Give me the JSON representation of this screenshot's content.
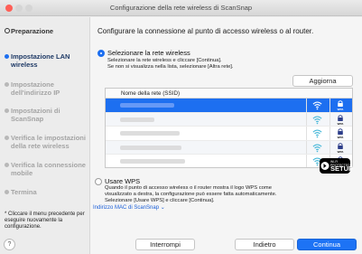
{
  "window": {
    "title": "Configurazione della rete wireless di ScanSnap"
  },
  "sidebar": {
    "steps": [
      {
        "label": "Preparazione",
        "state": "done"
      },
      {
        "label": "Impostazione LAN wireless",
        "state": "active"
      },
      {
        "label": "Impostazione dell'indirizzo IP",
        "state": "pending"
      },
      {
        "label": "Impostazioni di ScanSnap",
        "state": "pending"
      },
      {
        "label": "Verifica le impostazioni della rete wireless",
        "state": "pending"
      },
      {
        "label": "Verifica la connessione mobile",
        "state": "pending"
      },
      {
        "label": "Termina",
        "state": "pending"
      }
    ],
    "hint": "* Cliccare il menu precedente per eseguire nuovamente la configurazione.",
    "help_label": "?"
  },
  "main": {
    "heading": "Configurare la connessione al punto di accesso wireless o al router.",
    "option_select": {
      "label": "Selezionare la rete wireless",
      "desc": "Selezionare la rete wireless e cliccare [Continua].\nSe non si visualizza nella lista, selezionare [Altra rete].",
      "selected": true
    },
    "refresh_label": "Aggiorna",
    "table": {
      "column": "Nome della rete (SSID)",
      "rows": [
        {
          "selected": true,
          "wps": true
        },
        {
          "selected": false,
          "wps": true
        },
        {
          "selected": false,
          "wps": true
        },
        {
          "selected": false,
          "wps": true
        },
        {
          "selected": false,
          "wps": true
        }
      ],
      "wps_icon_text": "WPA"
    },
    "option_wps": {
      "label": "Usare WPS",
      "desc": "Quando il punto di accesso wireless o il router mostra il logo WPS come\nvisualizzato a destra, la configurazione può essere fatta automaticamente.\nSelezionare [Usare WPS] e cliccare [Continua].",
      "selected": false
    },
    "wps_logo": {
      "small": "Wi-Fi PROTECTED",
      "big": "SETUP"
    },
    "mac_link": "Indirizzo MAC di ScanSnap",
    "buttons": {
      "stop": "Interrompi",
      "back": "Indietro",
      "next": "Continua"
    }
  },
  "colors": {
    "accent": "#1d6ff0",
    "selected_row": "#1d6ff0"
  }
}
